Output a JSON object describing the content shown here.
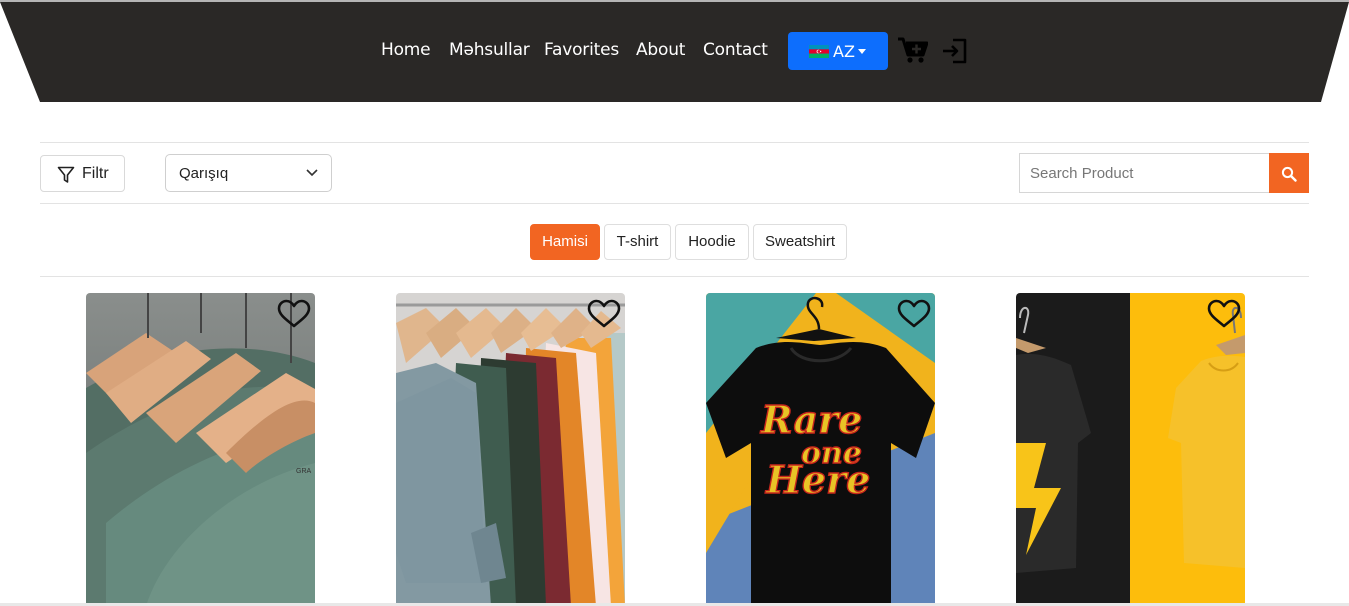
{
  "nav": {
    "links": [
      "Home",
      "Məhsullar",
      "Favorites",
      "About",
      "Contact"
    ],
    "language": "AZ",
    "flag_icon": "azerbaijan-flag-icon",
    "cart_icon": "cart-plus-icon",
    "login_icon": "login-icon"
  },
  "toolbar": {
    "filter_label": "Filtr",
    "sort_value": "Qarışıq",
    "search_placeholder": "Search Product",
    "search_icon": "search-icon"
  },
  "categories": [
    "Hamisi",
    "T-shirt",
    "Hoodie",
    "Sweatshirt"
  ],
  "active_category": "Hamisi",
  "products": [
    {
      "image": "green-tshirts-on-hangers",
      "favorite_icon": "heart-icon"
    },
    {
      "image": "colorful-tshirts-rack",
      "favorite_icon": "heart-icon"
    },
    {
      "image": "black-tshirt-rare-one-here",
      "print_text_line1": "Rare",
      "print_text_line2": "one",
      "print_text_line3": "Here",
      "favorite_icon": "heart-icon"
    },
    {
      "image": "black-and-yellow-tshirts",
      "favorite_icon": "heart-icon"
    }
  ],
  "colors": {
    "header_bg": "#2a2826",
    "accent": "#f26522",
    "language_button": "#0d6efd"
  }
}
